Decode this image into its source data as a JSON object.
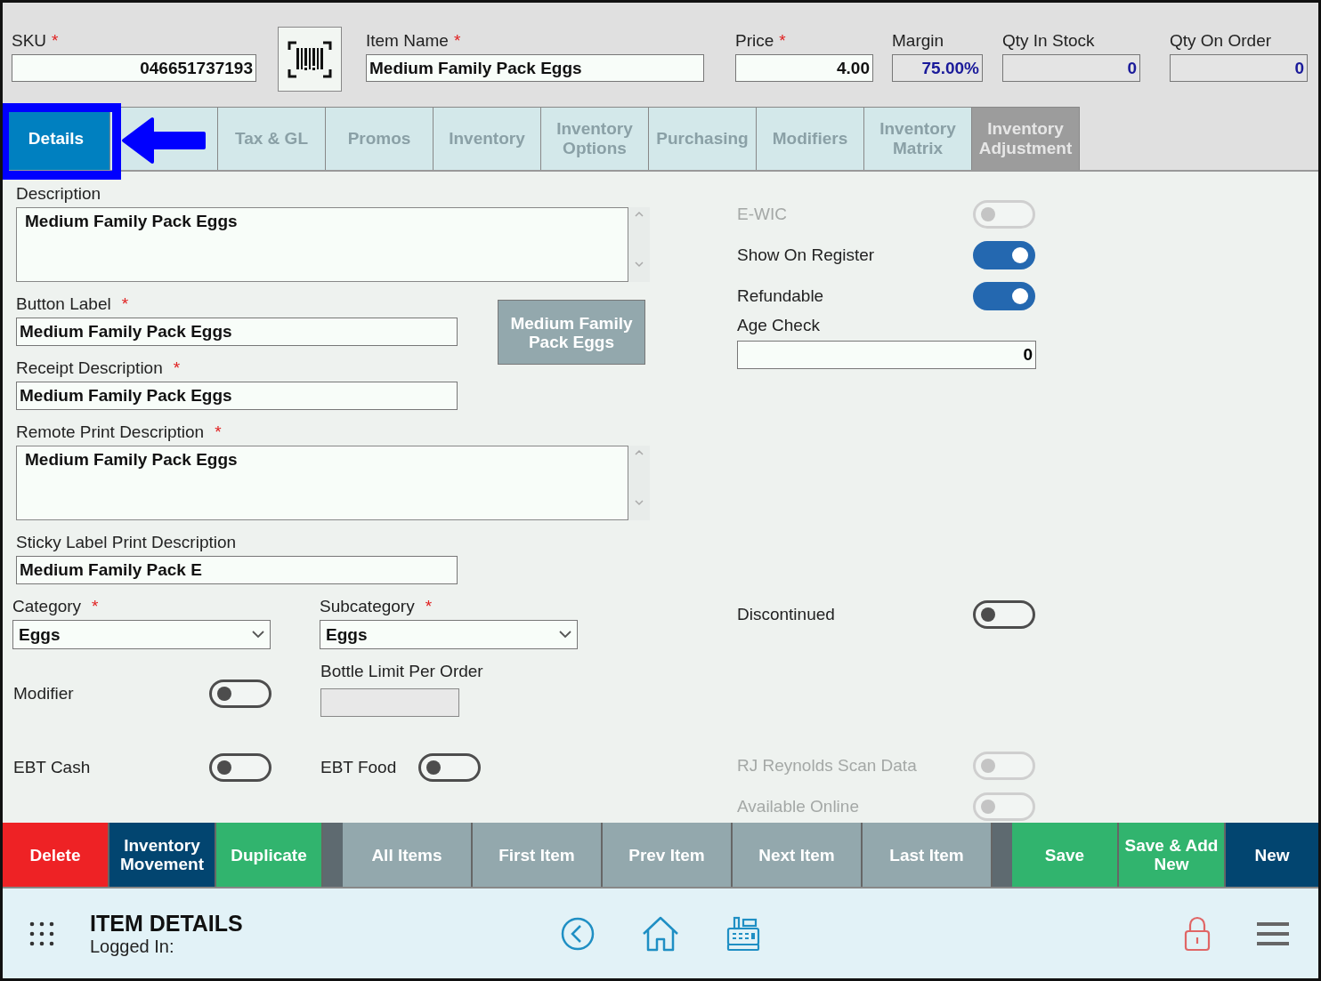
{
  "header": {
    "fields": [
      {
        "kind": "number",
        "label": "SKU",
        "required_mark": "*",
        "value": "046651737193"
      },
      {
        "kind": "scan-button"
      },
      {
        "kind": "text",
        "label": "Item Name",
        "required_mark": "*",
        "value": "Medium Family Pack Eggs"
      },
      {
        "kind": "number",
        "label": "Price",
        "required_mark": "*",
        "value": "4.00"
      },
      {
        "kind": "readonly",
        "label": "Margin",
        "value": "75.00%"
      },
      {
        "kind": "readonly",
        "label": "Qty In Stock",
        "value": "0"
      },
      {
        "kind": "readonly",
        "label": "Qty On Order",
        "value": "0"
      }
    ]
  },
  "tabs": [
    {
      "label": "Details",
      "selected": true,
      "disabled": false
    },
    {
      "selected": false,
      "disabled": false
    },
    {
      "label": "Tax & GL",
      "selected": false,
      "disabled": false
    },
    {
      "label": "Promos",
      "selected": false,
      "disabled": false
    },
    {
      "label": "Inventory",
      "selected": false,
      "disabled": false
    },
    {
      "label": "Inventory Options",
      "selected": false,
      "disabled": false
    },
    {
      "label": "Purchasing",
      "selected": false,
      "disabled": false
    },
    {
      "label": "Modifiers",
      "selected": false,
      "disabled": false
    },
    {
      "label": "Inventory Matrix",
      "selected": false,
      "disabled": false
    },
    {
      "label": "Inventory Adjustment",
      "selected": false,
      "disabled": true
    }
  ],
  "form": {
    "description": {
      "label": "Description",
      "value": "Medium Family Pack Eggs"
    },
    "button_label": {
      "label": "Button Label",
      "required_mark": "*",
      "value": "Medium Family Pack Eggs"
    },
    "button_preview": "Medium Family Pack Eggs",
    "receipt_description": {
      "label": "Receipt Description",
      "required_mark": "*",
      "value": "Medium Family Pack Eggs"
    },
    "remote_print_description": {
      "label": "Remote Print Description",
      "required_mark": "*",
      "value": "Medium Family Pack Eggs"
    },
    "sticky_label_print_description": {
      "label": "Sticky Label Print Description",
      "value": "Medium Family Pack E"
    },
    "category": {
      "label": "Category",
      "required_mark": "*",
      "value": "Eggs"
    },
    "subcategory": {
      "label": "Subcategory",
      "required_mark": "*",
      "value": "Eggs"
    },
    "modifier": {
      "label": "Modifier",
      "on": false
    },
    "bottle_limit_per_order": {
      "label": "Bottle Limit Per Order"
    },
    "ebt_cash": {
      "label": "EBT Cash",
      "on": false
    },
    "ebt_food": {
      "label": "EBT Food",
      "on": false
    }
  },
  "settings": [
    {
      "kind": "switch",
      "label": "E-WIC",
      "on": false,
      "disabled": true
    },
    {
      "kind": "switch",
      "label": "Show On Register",
      "on": true,
      "disabled": false
    },
    {
      "kind": "switch",
      "label": "Refundable",
      "on": true,
      "disabled": false
    },
    {
      "kind": "number",
      "label": "Age Check",
      "value": "0"
    },
    {
      "kind": "switch",
      "label": "Discontinued",
      "on": false,
      "disabled": false
    },
    {
      "kind": "switch",
      "label": "RJ Reynolds Scan Data",
      "on": false,
      "disabled": true
    },
    {
      "kind": "switch",
      "label": "Available Online",
      "on": false,
      "disabled": true
    }
  ],
  "actions": [
    {
      "kind": "action",
      "label": "Delete",
      "color": "#ee2225"
    },
    {
      "kind": "action",
      "label": "Inventory Movement",
      "color": "#024570"
    },
    {
      "kind": "action",
      "label": "Duplicate",
      "color": "#31b46e"
    },
    {
      "kind": "nav",
      "label": "All Items",
      "color": "#93a8ad"
    },
    {
      "kind": "nav",
      "label": "First Item",
      "color": "#93a8ad"
    },
    {
      "kind": "nav",
      "label": "Prev Item",
      "color": "#93a8ad"
    },
    {
      "kind": "nav",
      "label": "Next Item",
      "color": "#93a8ad"
    },
    {
      "kind": "nav",
      "label": "Last Item",
      "color": "#93a8ad"
    },
    {
      "kind": "action",
      "label": "Save",
      "color": "#31b46e"
    },
    {
      "kind": "action",
      "label": "Save & Add New",
      "color": "#31b46e"
    },
    {
      "kind": "action",
      "label": "New",
      "color": "#024570"
    }
  ],
  "footer": {
    "title": "ITEM DETAILS",
    "logged_in": "Logged In:"
  }
}
